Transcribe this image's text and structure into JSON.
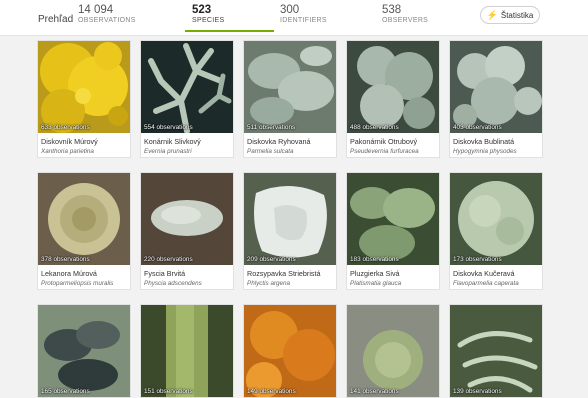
{
  "header": {
    "title": "Prehľad",
    "stats": [
      {
        "number": "14 094",
        "label": "OBSERVATIONS"
      },
      {
        "number": "523",
        "label": "SPECIES"
      },
      {
        "number": "300",
        "label": "IDENTIFIERS"
      },
      {
        "number": "538",
        "label": "OBSERVERS"
      }
    ],
    "statistics_button": "Štatistika"
  },
  "species": [
    {
      "count": "633 observations",
      "common": "Diskovník Múrový",
      "scientific": "Xanthoria parietina"
    },
    {
      "count": "554 observations",
      "common": "Konárnik Slivkový",
      "scientific": "Evernia prunastri"
    },
    {
      "count": "511 observations",
      "common": "Diskovka Ryhovaná",
      "scientific": "Parmelia sulcata"
    },
    {
      "count": "488 observations",
      "common": "Pakonárnik Otrubový",
      "scientific": "Pseudevernia furfuracea"
    },
    {
      "count": "403 observations",
      "common": "Diskovka Bublinatá",
      "scientific": "Hypogymnia physodes"
    },
    {
      "count": "378 observations",
      "common": "Lekanora Múrová",
      "scientific": "Protoparmeliopsis muralis"
    },
    {
      "count": "220 observations",
      "common": "Fyscia Brvitá",
      "scientific": "Physcia adscendens"
    },
    {
      "count": "209 observations",
      "common": "Rozsypavka Striebristá",
      "scientific": "Phlyctis argena"
    },
    {
      "count": "183 observations",
      "common": "Pluzgierka Sivá",
      "scientific": "Platismatia glauca"
    },
    {
      "count": "173 observations",
      "common": "Diskovka Kučeravá",
      "scientific": "Flavoparmelia caperata"
    },
    {
      "count": "165 observations",
      "common": "",
      "scientific": ""
    },
    {
      "count": "151 observations",
      "common": "",
      "scientific": ""
    },
    {
      "count": "149 observations",
      "common": "",
      "scientific": ""
    },
    {
      "count": "141 observations",
      "common": "",
      "scientific": ""
    },
    {
      "count": "139 observations",
      "common": "",
      "scientific": ""
    }
  ],
  "colors": {
    "accent": "#74ac00"
  }
}
